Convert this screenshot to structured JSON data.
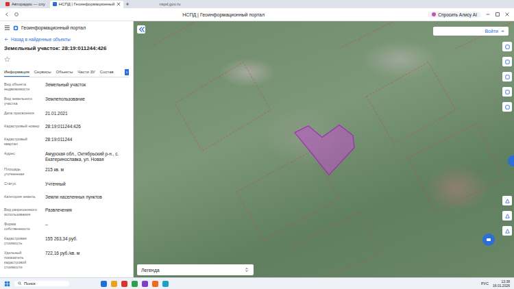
{
  "browser": {
    "tabs": [
      {
        "label": "Авторадио — слу",
        "selected": false
      },
      {
        "label": "НСПД | Геоинформационный",
        "selected": true
      }
    ],
    "url": "nspd.gov.ru",
    "page_title": "НСПД | Геоинформационный портал",
    "alice": "Спросить Алису AI"
  },
  "header": {
    "title": "Геоинформационный портал",
    "login": "Войти"
  },
  "panel": {
    "back": "Назад в найденные объекты",
    "title": "Земельный участок: 28:19:011244:426",
    "favorite": false,
    "tabs": [
      {
        "label": "Информация",
        "selected": true
      },
      {
        "label": "Сервисы",
        "selected": false
      },
      {
        "label": "Объекты",
        "selected": false
      },
      {
        "label": "Части ЗУ",
        "selected": false
      },
      {
        "label": "Состав",
        "selected": false
      }
    ],
    "tabs_more": "›",
    "fields": [
      {
        "label": "Вид объекта недвижимости",
        "value": "Земельный участок"
      },
      {
        "label": "Вид земельного участка",
        "value": "Землепользование"
      },
      {
        "label": "Дата присвоения",
        "value": "21.01.2021"
      },
      {
        "label": "Кадастровый номер",
        "value": "28:19:011244:426"
      },
      {
        "label": "Кадастровый квартал",
        "value": "28:19:011244"
      },
      {
        "label": "Адрес",
        "value": "Амурская обл., Октябрьский р-н., с. Екатеринославка, ул. Новая"
      },
      {
        "label": "Площадь уточненная",
        "value": "215 кв. м"
      },
      {
        "label": "Статус",
        "value": "Учтенный"
      },
      {
        "label": "Категория земель",
        "value": "Земли населенных пунктов"
      },
      {
        "label": "Вид разрешенного использования",
        "value": "Развлечения"
      },
      {
        "label": "Форма собственности",
        "value": "–"
      },
      {
        "label": "Кадастровая стоимость",
        "value": "155 263,34 руб."
      },
      {
        "label": "Удельный показатель кадастровой стоимости",
        "value": "722,16 руб./кв. м"
      }
    ]
  },
  "map": {
    "legend": "Легенда"
  },
  "taskbar": {
    "search": "Поиск",
    "lang": "РУС",
    "time": "13:38",
    "date": "16.01.2026"
  }
}
